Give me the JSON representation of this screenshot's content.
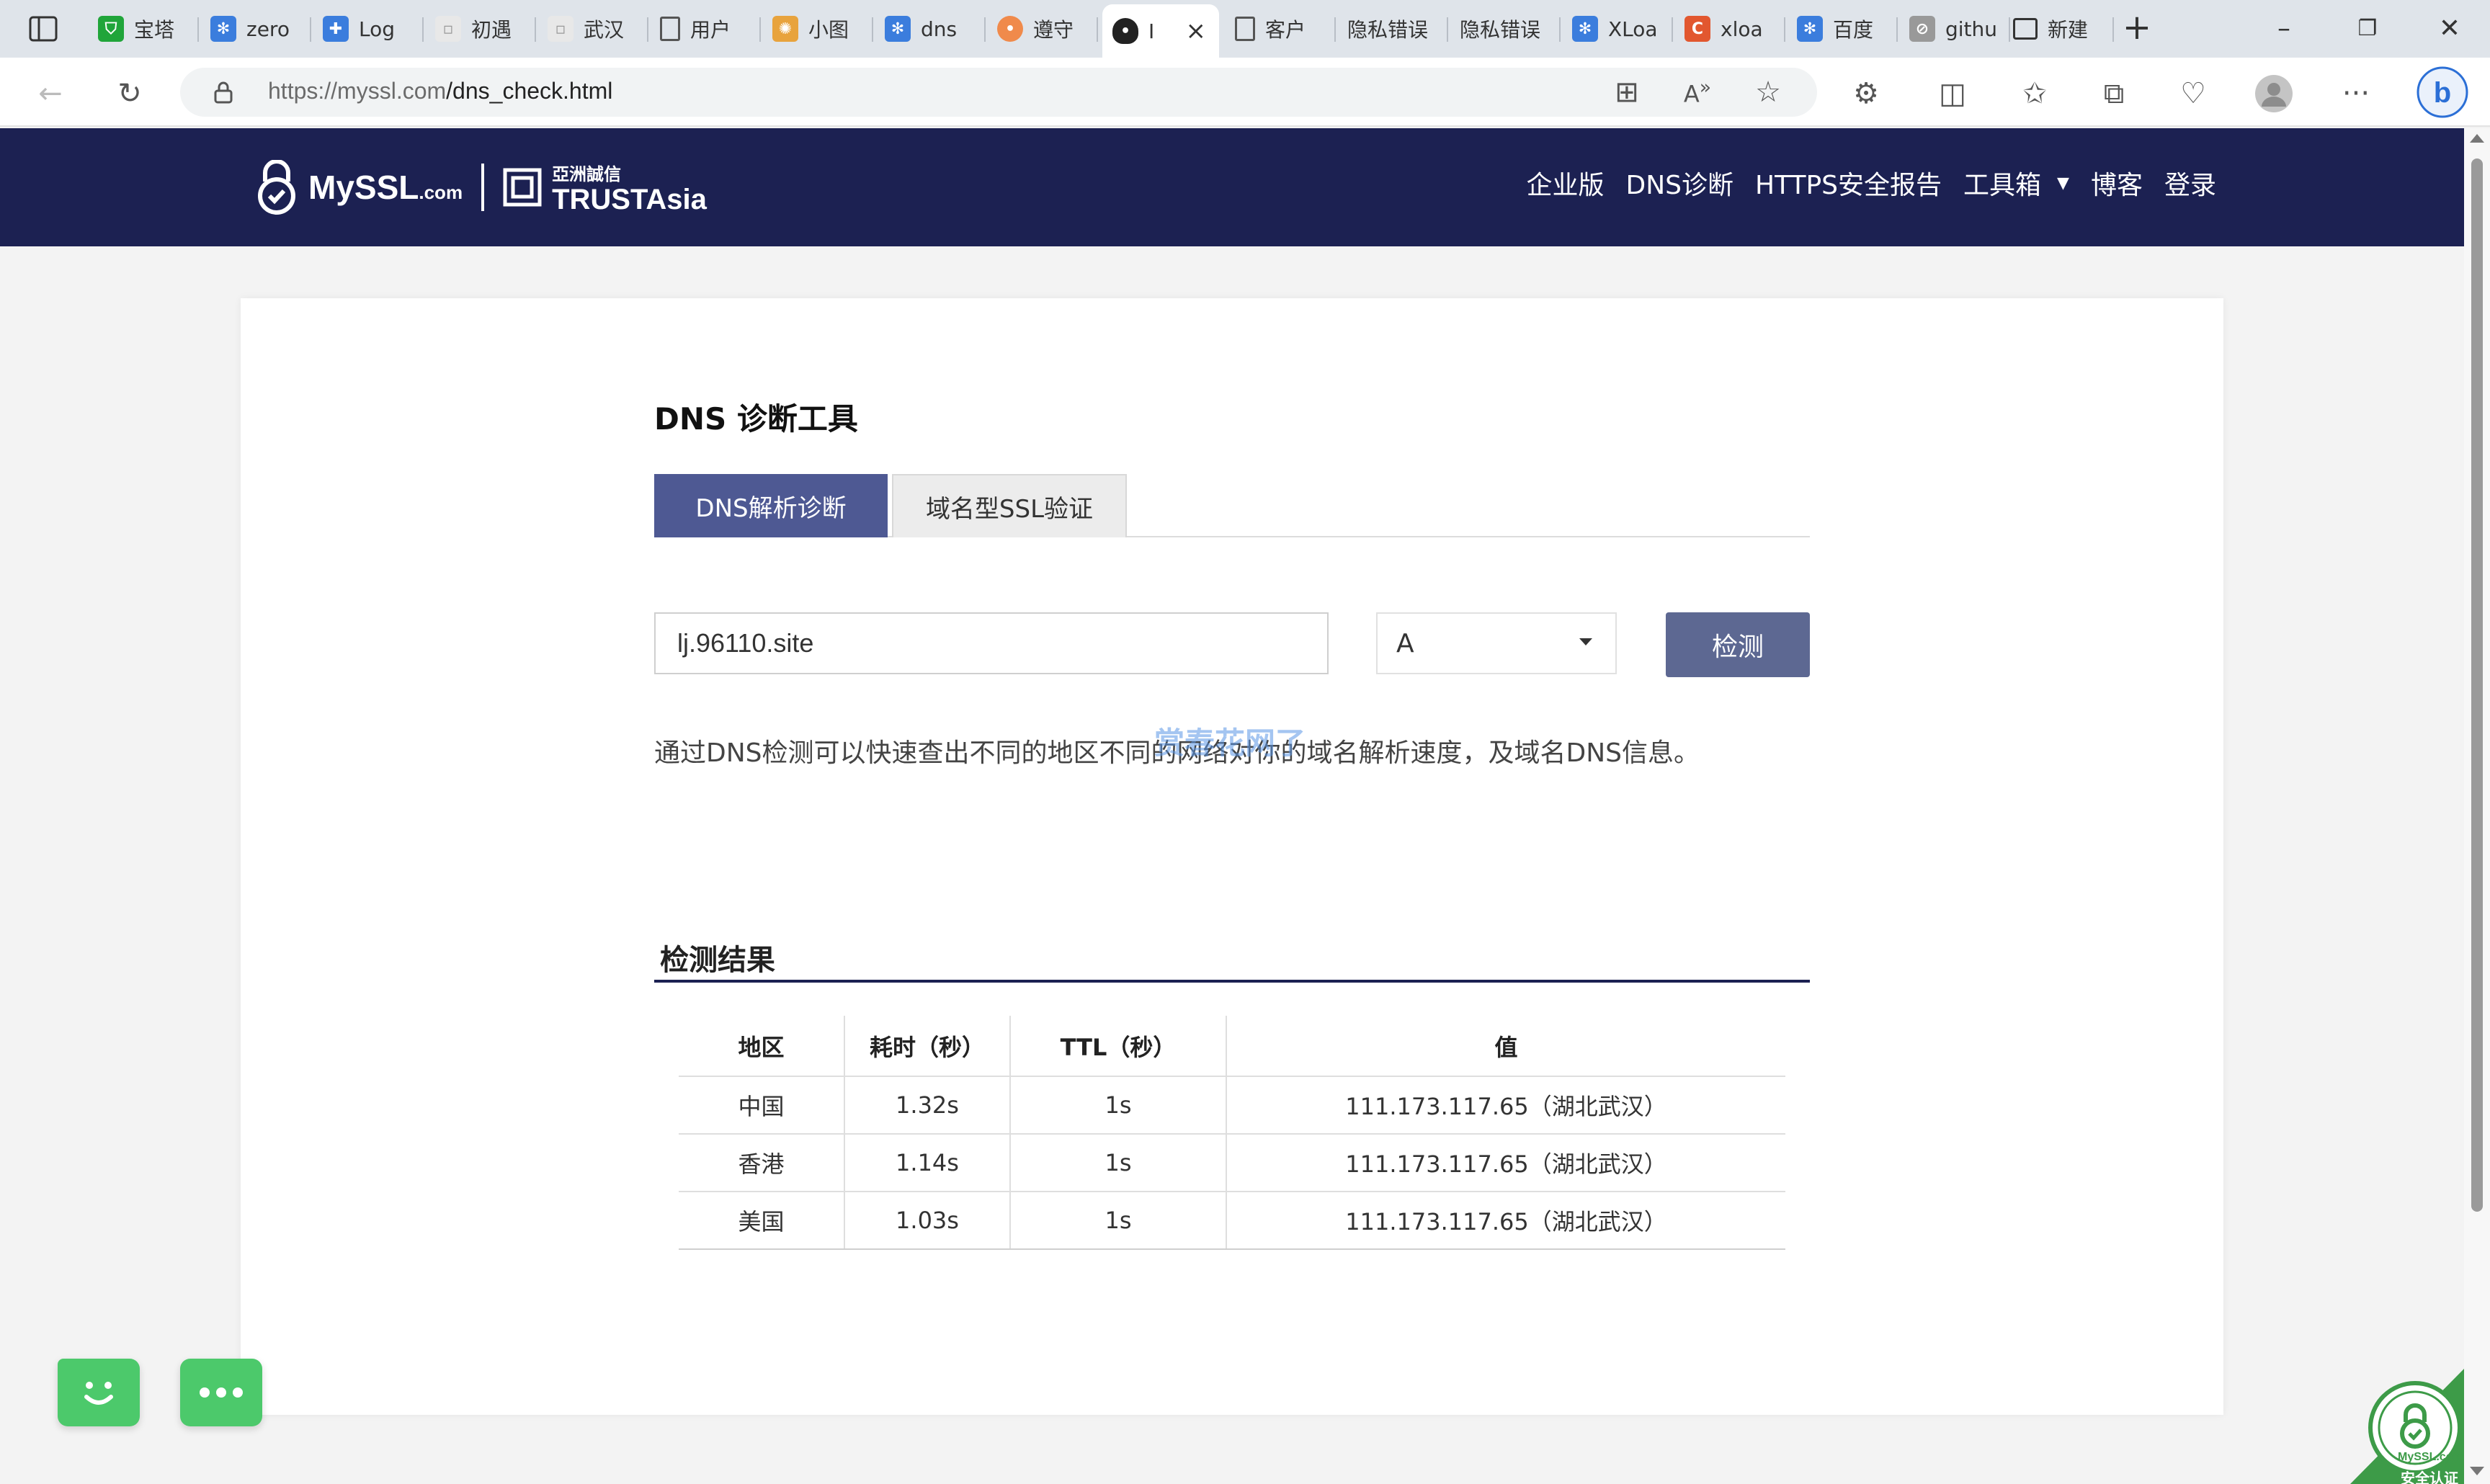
{
  "browser": {
    "tabs": [
      {
        "label": "宝塔",
        "icon": "shield-icon",
        "color": "#20a53a"
      },
      {
        "label": "zero",
        "icon": "paw-icon",
        "color": "#3b7ddd"
      },
      {
        "label": "Log",
        "icon": "puzzle-icon",
        "color": "#3b7ddd"
      },
      {
        "label": "初遇",
        "icon": "page-icon",
        "color": "#bbbbbb"
      },
      {
        "label": "武汉",
        "icon": "page-icon",
        "color": "#bbbbbb"
      },
      {
        "label": "用户",
        "icon": "document-icon",
        "color": "#555555"
      },
      {
        "label": "小图",
        "icon": "pinwheel-icon",
        "color": "#e8a33d"
      },
      {
        "label": "dns",
        "icon": "paw-icon",
        "color": "#3b7ddd"
      },
      {
        "label": "遵守",
        "icon": "bubble-icon",
        "color": "#f08a4b"
      },
      {
        "label": "I",
        "icon": "lock-icon",
        "color": "#333333"
      },
      {
        "label": "客户",
        "icon": "document-icon",
        "color": "#555555"
      },
      {
        "label": "隐私错误",
        "icon": "",
        "color": ""
      },
      {
        "label": "隐私错误",
        "icon": "",
        "color": ""
      },
      {
        "label": "XLoa",
        "icon": "paw-icon",
        "color": "#3b7ddd"
      },
      {
        "label": "xloa",
        "icon": "c-icon",
        "color": "#e2572f"
      },
      {
        "label": "百度",
        "icon": "paw-icon",
        "color": "#3b7ddd"
      },
      {
        "label": "githu",
        "icon": "blocked-doc-icon",
        "color": "#888888"
      },
      {
        "label": "新建",
        "icon": "newtab-icon",
        "color": "#333333"
      }
    ],
    "url_host": "https://myssl.com",
    "url_path": "/dns_check.html"
  },
  "site": {
    "logo_text": "MySSL",
    "logo_suffix": ".com",
    "partner_text": "TRUSTAsia",
    "partner_cn": "亞洲誠信",
    "nav": [
      "企业版",
      "DNS诊断",
      "HTTPS安全报告",
      "工具箱",
      "博客",
      "登录"
    ]
  },
  "tool": {
    "title": "DNS 诊断工具",
    "tabs": [
      "DNS解析诊断",
      "域名型SSL验证"
    ],
    "domain_value": "lj.96110.site",
    "record_type": "A",
    "check_label": "检测",
    "description": "通过DNS检测可以快速查出不同的地区不同的网络对你的域名解析速度，及域名DNS信息。",
    "watermark": "赏春花网了"
  },
  "results": {
    "title": "检测结果",
    "headers": [
      "地区",
      "耗时（秒）",
      "TTL（秒）",
      "值"
    ],
    "rows": [
      [
        "中国",
        "1.32s",
        "1s",
        "111.173.117.65（湖北武汉）"
      ],
      [
        "香港",
        "1.14s",
        "1s",
        "111.173.117.65（湖北武汉）"
      ],
      [
        "美国",
        "1.03s",
        "1s",
        "111.173.117.65（湖北武汉）"
      ]
    ]
  },
  "seal": {
    "line1": "MySSL.com",
    "line2": "安全认证"
  },
  "colors": {
    "header_bg": "#1c2152",
    "accent": "#4e5993",
    "button": "#5d6892",
    "widget": "#4cc96b"
  }
}
